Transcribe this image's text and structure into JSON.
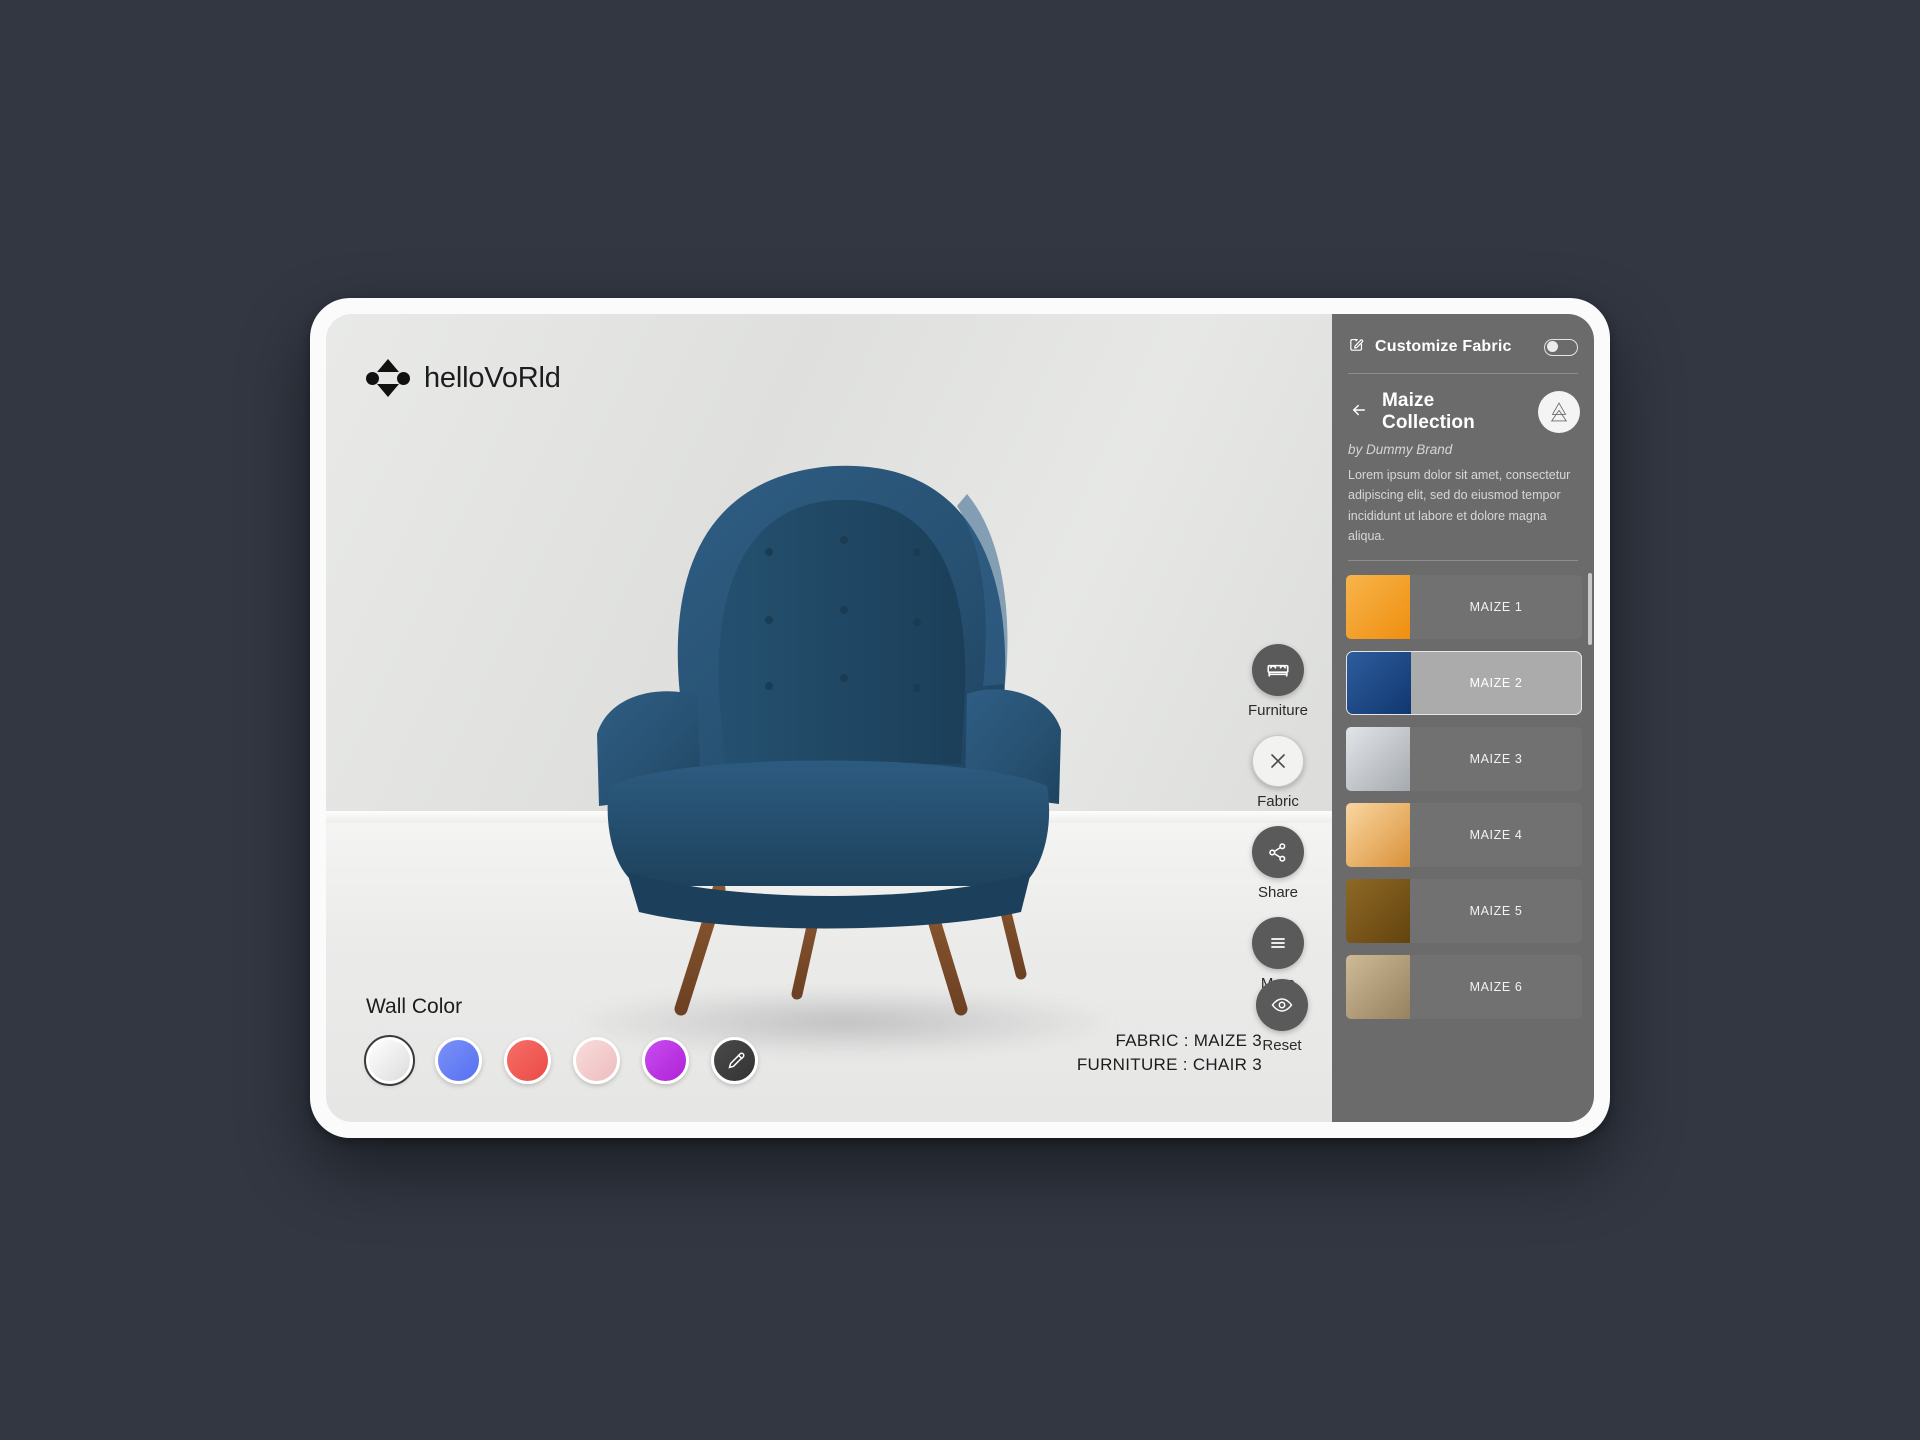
{
  "app": {
    "background_color": "#323742",
    "logo_text": "helloVoRld",
    "logo_icon": "hellovorld-diamond-logo"
  },
  "viewer": {
    "scene_alt": "blue wingback armchair in white room",
    "toolbar": [
      {
        "id": "furniture",
        "label": "Furniture",
        "icon": "sofa-icon",
        "active": false
      },
      {
        "id": "fabric",
        "label": "Fabric",
        "icon": "close-x-icon",
        "active": true
      },
      {
        "id": "share",
        "label": "Share",
        "icon": "share-icon",
        "active": false
      },
      {
        "id": "more",
        "label": "More",
        "icon": "hamburger-menu-icon",
        "active": false
      }
    ],
    "reset": {
      "label": "Reset",
      "icon": "eye-icon"
    }
  },
  "wall_color": {
    "title": "Wall Color",
    "swatches": [
      {
        "name": "white",
        "color": "#ededee",
        "selected": true,
        "icon": null
      },
      {
        "name": "blue",
        "color": "#6782f5",
        "selected": false,
        "icon": null
      },
      {
        "name": "red",
        "color": "#f15a56",
        "selected": false,
        "icon": null
      },
      {
        "name": "pink",
        "color": "#f3cccd",
        "selected": false,
        "icon": null
      },
      {
        "name": "purple",
        "color": "#bb37e0",
        "selected": false,
        "icon": null
      },
      {
        "name": "eyedropper",
        "color": "#3c3c3c",
        "selected": false,
        "icon": "eyedropper-icon"
      }
    ]
  },
  "info": {
    "fabric_line": "FABRIC : MAIZE 3",
    "furniture_line": "FURNITURE : CHAIR 3"
  },
  "panel": {
    "header": {
      "title": "Customize Fabric",
      "icon": "edit-pencil-icon",
      "toggle_on": false
    },
    "collection": {
      "back_icon": "arrow-left-icon",
      "title": "Maize Collection",
      "brand_icon": "triangle-tree-logo",
      "by_line": "by Dummy Brand",
      "description": "Lorem ipsum dolor sit amet, consectetur adipiscing elit, sed do eiusmod tempor incididunt ut labore et dolore magna aliqua."
    },
    "swatches": [
      {
        "label": "MAIZE 1",
        "color_from": "#f6ad3c",
        "color_to": "#f29314",
        "selected": false
      },
      {
        "label": "MAIZE 2",
        "color_from": "#2b5696",
        "color_to": "#123e77",
        "selected": true
      },
      {
        "label": "MAIZE 3",
        "color_from": "#d9dce0",
        "color_to": "#a9aeb3",
        "selected": false
      },
      {
        "label": "MAIZE 4",
        "color_from": "#f7cb8c",
        "color_to": "#dd9a44",
        "selected": false
      },
      {
        "label": "MAIZE 5",
        "color_from": "#8a6524",
        "color_to": "#6a4a12",
        "selected": false
      },
      {
        "label": "MAIZE 6",
        "color_from": "#cbb590",
        "color_to": "#9c8764",
        "selected": false
      }
    ]
  }
}
